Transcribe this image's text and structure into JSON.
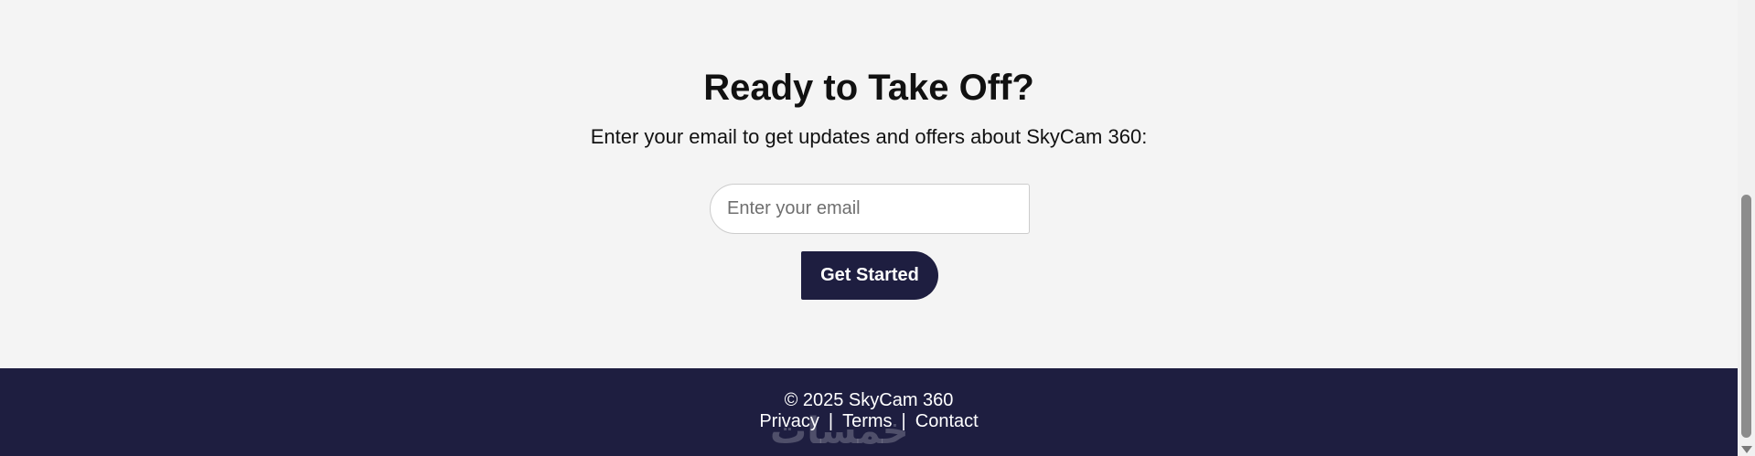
{
  "cta": {
    "title": "Ready to Take Off?",
    "subtitle": "Enter your email to get updates and offers about SkyCam 360:",
    "email_placeholder": "Enter your email",
    "button_label": "Get Started"
  },
  "footer": {
    "copyright": "© 2025 SkyCam 360",
    "links": [
      "Privacy",
      "Terms",
      "Contact"
    ],
    "separator": "|",
    "watermark": "خمسات"
  },
  "colors": {
    "section_bg": "#f4f4f4",
    "accent_navy": "#1e1e40",
    "text_dark": "#111111"
  }
}
